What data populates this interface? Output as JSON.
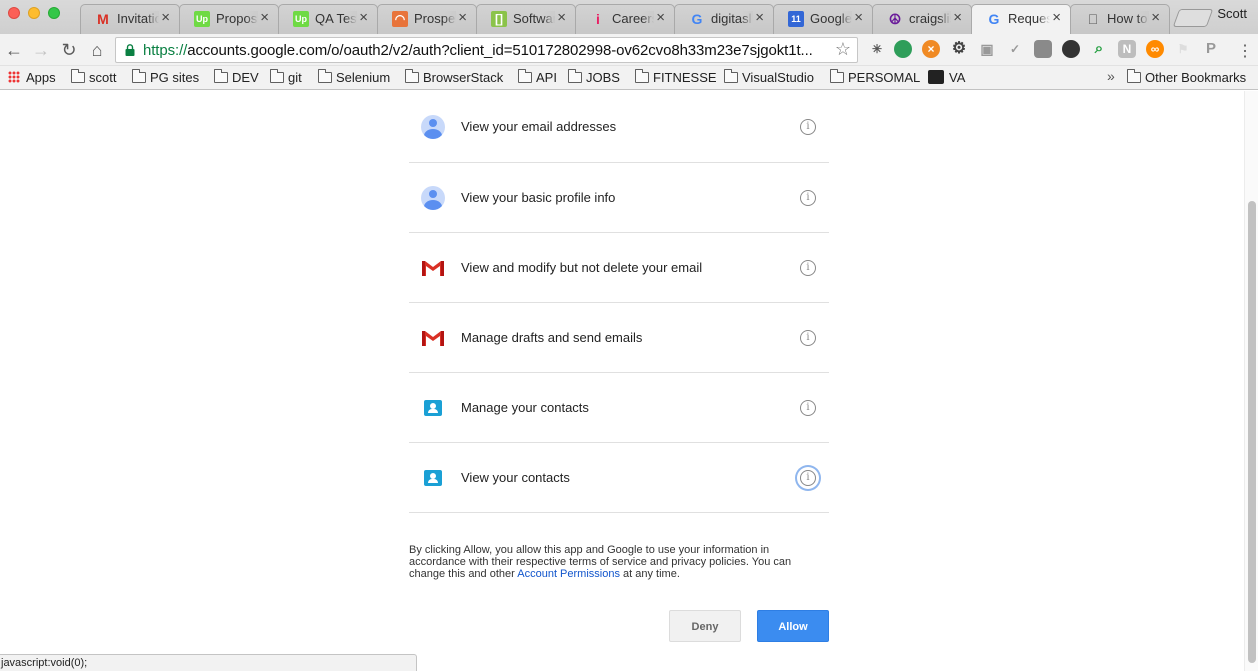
{
  "window": {
    "profile_name": "Scott"
  },
  "tabs": [
    {
      "title": "Invitatio",
      "icon": "gmail-icon",
      "color": "#d93025",
      "active": false
    },
    {
      "title": "Proposa",
      "icon": "upwork-icon",
      "color": "#6fda44",
      "active": false
    },
    {
      "title": "QA Test",
      "icon": "upwork-icon",
      "color": "#6fda44",
      "active": false
    },
    {
      "title": "Prospec",
      "icon": "rainbow-icon",
      "color": "#e8743b",
      "active": false
    },
    {
      "title": "Softwar",
      "icon": "green-flag-icon",
      "color": "#8bc34a",
      "active": false
    },
    {
      "title": "Careers",
      "icon": "info-i-icon",
      "color": "#e91e63",
      "active": false
    },
    {
      "title": "digitasl",
      "icon": "google-g-icon",
      "color": "#4285f4",
      "active": false
    },
    {
      "title": "Google",
      "icon": "calendar-icon",
      "color": "#3367d6",
      "active": false
    },
    {
      "title": "craigslis",
      "icon": "peace-icon",
      "color": "#6a1b9a",
      "active": false
    },
    {
      "title": "Request",
      "icon": "google-g-icon",
      "color": "#4285f4",
      "active": true
    },
    {
      "title": "How to",
      "icon": "apple-icon",
      "color": "#555555",
      "active": false
    }
  ],
  "toolbar": {
    "url_scheme": "https://",
    "url_rest": "accounts.google.com/o/oauth2/v2/auth?client_id=510172802998-ov62cvo8h33m23e7sjgokt1t..."
  },
  "bookmarks": {
    "apps": "Apps",
    "folders": [
      "scott",
      "PG sites",
      "DEV",
      "git",
      "Selenium",
      "BrowserStack",
      "API",
      "JOBS",
      "FITNESSE",
      "VisualStudio",
      "PERSOMAL"
    ],
    "va": "VA",
    "other": "Other Bookmarks"
  },
  "permissions": [
    {
      "text": "View your email addresses",
      "icon": "avatar-icon"
    },
    {
      "text": "View your basic profile info",
      "icon": "avatar-icon"
    },
    {
      "text": "View and modify but not delete your email",
      "icon": "gmail-icon"
    },
    {
      "text": "Manage drafts and send emails",
      "icon": "gmail-icon"
    },
    {
      "text": "Manage your contacts",
      "icon": "contacts-icon"
    },
    {
      "text": "View your contacts",
      "icon": "contacts-icon"
    }
  ],
  "consent": {
    "text_before": "By clicking Allow, you allow this app and Google to use your information in accordance with their respective terms of service and privacy policies. You can change this and other ",
    "link": "Account Permissions",
    "text_after": " at any time."
  },
  "buttons": {
    "deny": "Deny",
    "allow": "Allow"
  },
  "status_bar": "javascript:void(0);",
  "colors": {
    "allow_button": "#3b8cf0",
    "link": "#1155cc",
    "gmail_red": "#d93025",
    "contacts_blue": "#1aa0d5"
  }
}
